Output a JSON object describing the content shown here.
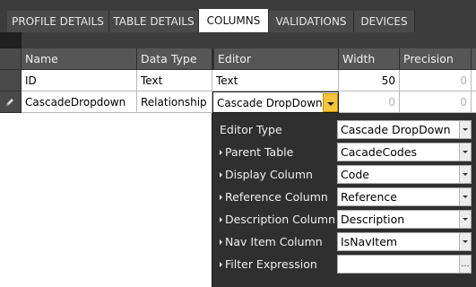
{
  "tabs": [
    {
      "label": "PROFILE DETAILS",
      "active": false
    },
    {
      "label": "TABLE DETAILS",
      "active": false
    },
    {
      "label": "COLUMNS",
      "active": true
    },
    {
      "label": "VALIDATIONS",
      "active": false
    },
    {
      "label": "DEVICES",
      "active": false
    }
  ],
  "grid": {
    "headers": {
      "name": "Name",
      "data_type": "Data Type",
      "editor": "Editor",
      "width": "Width",
      "precision": "Precision"
    },
    "rows": [
      {
        "name": "ID",
        "data_type": "Text",
        "editor": "Text",
        "width": "50",
        "precision": "0",
        "extra": "0"
      },
      {
        "name": "CascadeDropdown",
        "data_type": "Relationship",
        "editor": "Cascade DropDown",
        "width": "0",
        "precision": "0",
        "extra": "0",
        "editing": true
      }
    ]
  },
  "popup": {
    "properties": [
      {
        "label": "Editor Type",
        "value": "Cascade DropDown",
        "expandable": false,
        "button": "dropdown"
      },
      {
        "label": "Parent Table",
        "value": "CacadeCodes",
        "expandable": true,
        "button": "dropdown"
      },
      {
        "label": "Display Column",
        "value": "Code",
        "expandable": true,
        "button": "dropdown"
      },
      {
        "label": "Reference Column",
        "value": "Reference",
        "expandable": true,
        "button": "dropdown"
      },
      {
        "label": "Description Column",
        "value": "Description",
        "expandable": true,
        "button": "dropdown"
      },
      {
        "label": "Nav Item Column",
        "value": "IsNavItem",
        "expandable": true,
        "button": "dropdown"
      },
      {
        "label": "Filter Expression",
        "value": "",
        "expandable": true,
        "button": "ellipsis",
        "button_label": "..."
      }
    ]
  },
  "colors": {
    "accent_dropdown": "#f6c33d",
    "header_bg": "#565656",
    "tab_bg": "#4a4a4a",
    "popup_bg": "#2f2f2f"
  },
  "icons": {
    "row_edit": "pencil-icon"
  }
}
